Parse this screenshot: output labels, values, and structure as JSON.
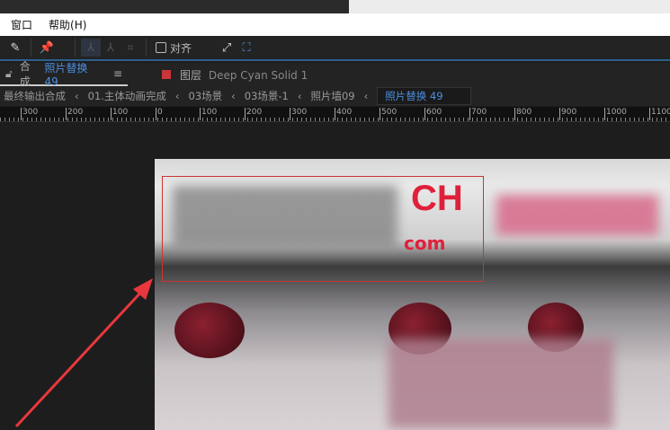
{
  "menu": {
    "items": [
      "窗口",
      "帮助(H)"
    ]
  },
  "toolbar": {
    "snap_label": "对齐"
  },
  "tabs": {
    "comp_prefix": "合成",
    "comp_name": "照片替换 49",
    "layer_prefix": "图层",
    "layer_name": "Deep Cyan Solid 1",
    "layer_color": "#c8353a"
  },
  "breadcrumbs": [
    "最终输出合成",
    "01.主体动画完成",
    "03场景",
    "03场景-1",
    "照片墙09",
    "照片替换 49"
  ],
  "ruler": {
    "labels": [
      "300",
      "200",
      "100",
      "0",
      "100",
      "200",
      "300",
      "400",
      "500",
      "600",
      "700",
      "800",
      "900",
      "1000",
      "1100"
    ]
  },
  "photo": {
    "logo_text": "CH",
    "logo_sub": "com"
  },
  "accent": "#4a8fe0",
  "arrow_color": "#e8383d"
}
